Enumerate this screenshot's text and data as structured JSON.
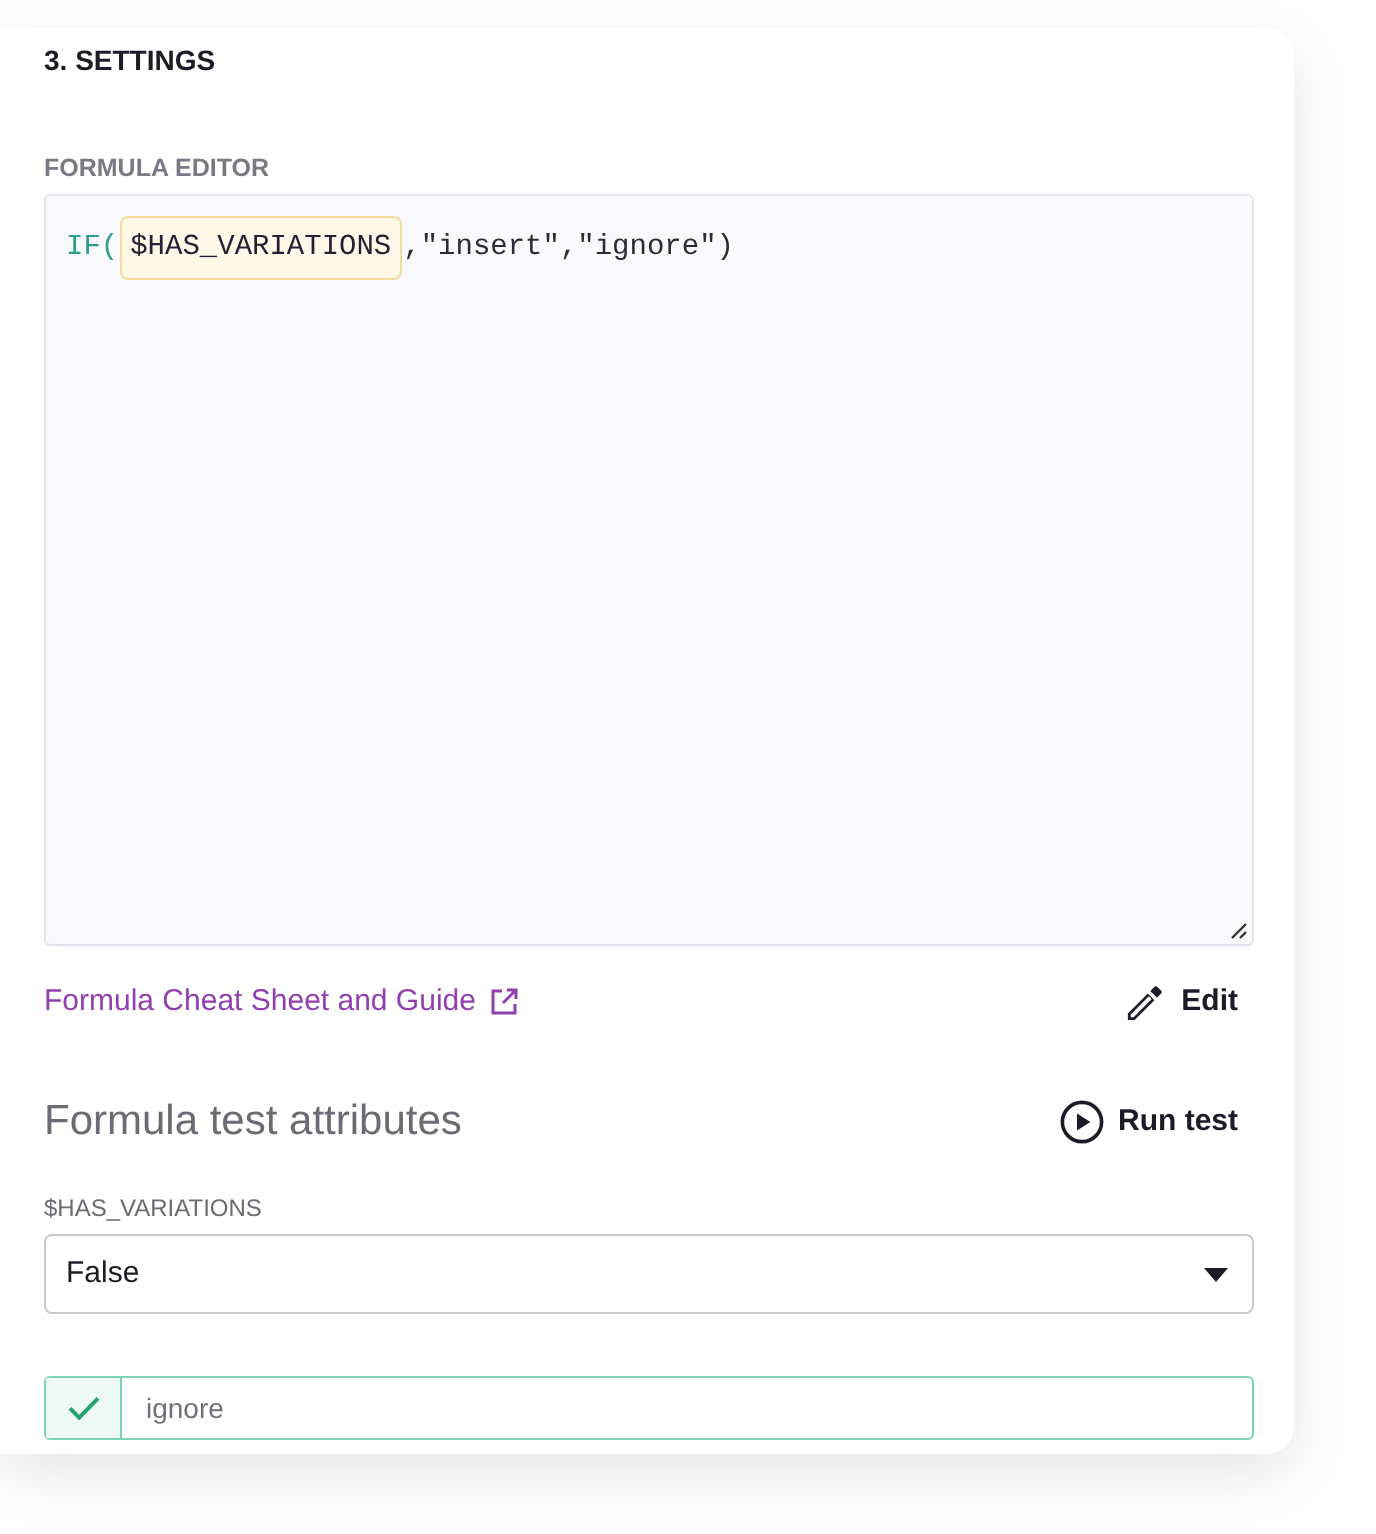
{
  "section": {
    "title": "3. SETTINGS"
  },
  "formula_editor": {
    "label": "FORMULA EDITOR",
    "tokens": [
      {
        "kind": "function",
        "text": "IF("
      },
      {
        "kind": "variable",
        "text": "$HAS_VARIATIONS"
      },
      {
        "kind": "plain",
        "text": ",\"insert\",\"ignore\")"
      }
    ]
  },
  "guide_link": {
    "label": "Formula Cheat Sheet and Guide"
  },
  "edit_button": {
    "label": "Edit"
  },
  "test": {
    "title": "Formula test attributes",
    "run_button": {
      "label": "Run test"
    },
    "attributes": [
      {
        "name": "$HAS_VARIATIONS",
        "value": "False"
      }
    ],
    "result": {
      "passed": true,
      "value": "ignore"
    }
  }
}
